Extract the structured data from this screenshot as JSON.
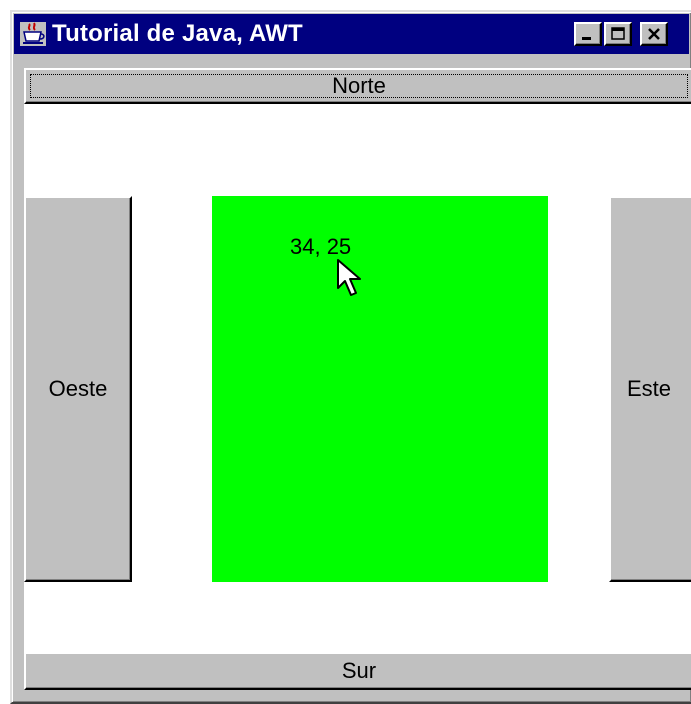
{
  "window": {
    "title": "Tutorial de Java, AWT",
    "title_bar_color": "#000080",
    "app_icon": "java-cup-icon",
    "controls": {
      "minimize_icon": "minimize-icon",
      "maximize_icon": "maximize-icon",
      "close_icon": "close-icon"
    }
  },
  "layout": {
    "north_label": "Norte",
    "south_label": "Sur",
    "west_label": "Oeste",
    "east_label": "Este"
  },
  "canvas": {
    "background_color": "#00ff00",
    "coordinates_text": "34, 25",
    "cursor_icon": "arrow-cursor-icon"
  }
}
